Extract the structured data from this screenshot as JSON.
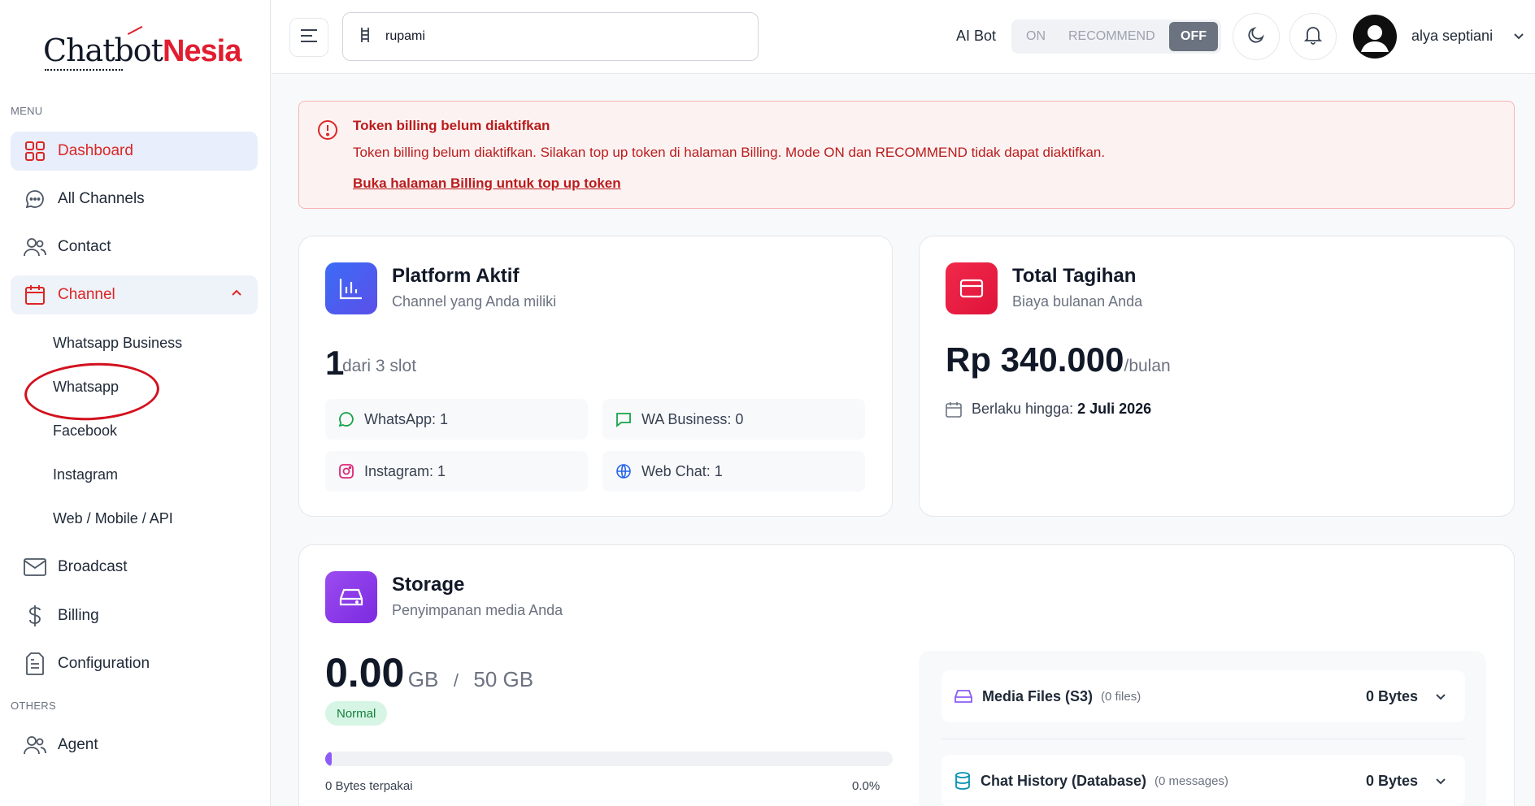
{
  "brand": {
    "part1": "Chatbot",
    "part2": "Nesia"
  },
  "sidebar": {
    "menu_label": "MENU",
    "others_label": "OTHERS",
    "items": {
      "dashboard": "Dashboard",
      "all_channels": "All Channels",
      "contact": "Contact",
      "channel": "Channel",
      "broadcast": "Broadcast",
      "billing": "Billing",
      "configuration": "Configuration",
      "agent": "Agent"
    },
    "channel_sub": {
      "whatsapp_business": "Whatsapp Business",
      "whatsapp": "Whatsapp",
      "facebook": "Facebook",
      "instagram": "Instagram",
      "web_mobile_api": "Web / Mobile / API"
    }
  },
  "header": {
    "search_value": "rupami",
    "ai_bot_label": "AI Bot",
    "modes": {
      "on": "ON",
      "recommend": "RECOMMEND",
      "off": "OFF"
    },
    "selected_mode": "OFF",
    "user_name": "alya septiani"
  },
  "alert": {
    "title": "Token billing belum diaktifkan",
    "message": "Token billing belum diaktifkan. Silakan top up token di halaman Billing. Mode ON dan RECOMMEND tidak dapat diaktifkan.",
    "link": "Buka halaman Billing untuk top up token"
  },
  "platform": {
    "title": "Platform Aktif",
    "subtitle": "Channel yang Anda miliki",
    "count": "1",
    "count_suffix": "dari 3 slot",
    "channels": {
      "whatsapp": "WhatsApp: 1",
      "wa_business": "WA Business: 0",
      "instagram": "Instagram: 1",
      "web_chat": "Web Chat: 1"
    }
  },
  "billing_card": {
    "title": "Total Tagihan",
    "subtitle": "Biaya bulanan Anda",
    "amount": "Rp 340.000",
    "period": "/bulan",
    "valid_label": "Berlaku hingga:",
    "valid_date": "2 Juli 2026"
  },
  "storage": {
    "title": "Storage",
    "subtitle": "Penyimpanan media Anda",
    "used": "0.00",
    "used_unit": "GB",
    "separator": "/",
    "total": "50 GB",
    "status": "Normal",
    "used_text": "0 Bytes terpakai",
    "percent_text": "0.0%",
    "progress_fraction": 0.0,
    "rows": {
      "media_name": "Media Files (S3)",
      "media_count": "(0 files)",
      "media_size": "0 Bytes",
      "chat_name": "Chat History (Database)",
      "chat_count": "(0 messages)",
      "chat_size": "0 Bytes"
    }
  },
  "colors": {
    "accent_red": "#dc2626",
    "platform_icon": "#4f5ff0",
    "billing_icon": "#e8153f",
    "storage_icon": "#8b35e8",
    "progress": "#8b5cf6",
    "annotation": "#d2111e"
  }
}
